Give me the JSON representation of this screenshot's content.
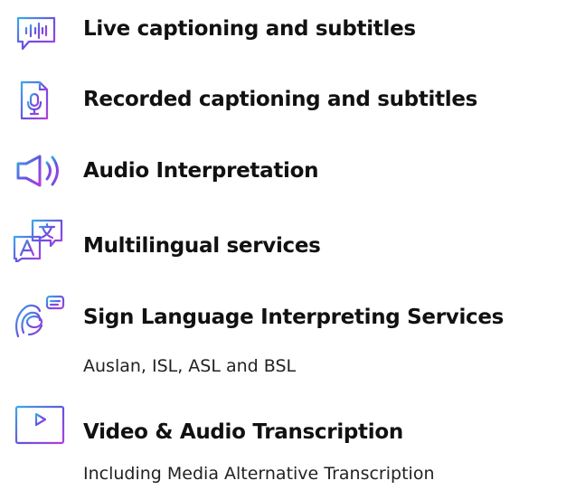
{
  "colors": {
    "gradient_start": "#3aa8e8",
    "gradient_mid": "#6a4fe0",
    "gradient_end": "#b13ee0",
    "text": "#111111"
  },
  "services": [
    {
      "icon": "speech-bubble-waveform-icon",
      "title": "Live captioning and subtitles"
    },
    {
      "icon": "document-microphone-icon",
      "title": "Recorded captioning and subtitles"
    },
    {
      "icon": "speaker-icon",
      "title": "Audio Interpretation"
    },
    {
      "icon": "translate-icon",
      "title": "Multilingual services"
    },
    {
      "icon": "sign-language-hand-icon",
      "title": "Sign Language Interpreting Services",
      "subtitle": "Auslan, ISL, ASL and BSL"
    },
    {
      "icon": "video-player-icon",
      "title": "Video & Audio Transcription",
      "subtitle": "Including Media Alternative Transcription"
    }
  ]
}
